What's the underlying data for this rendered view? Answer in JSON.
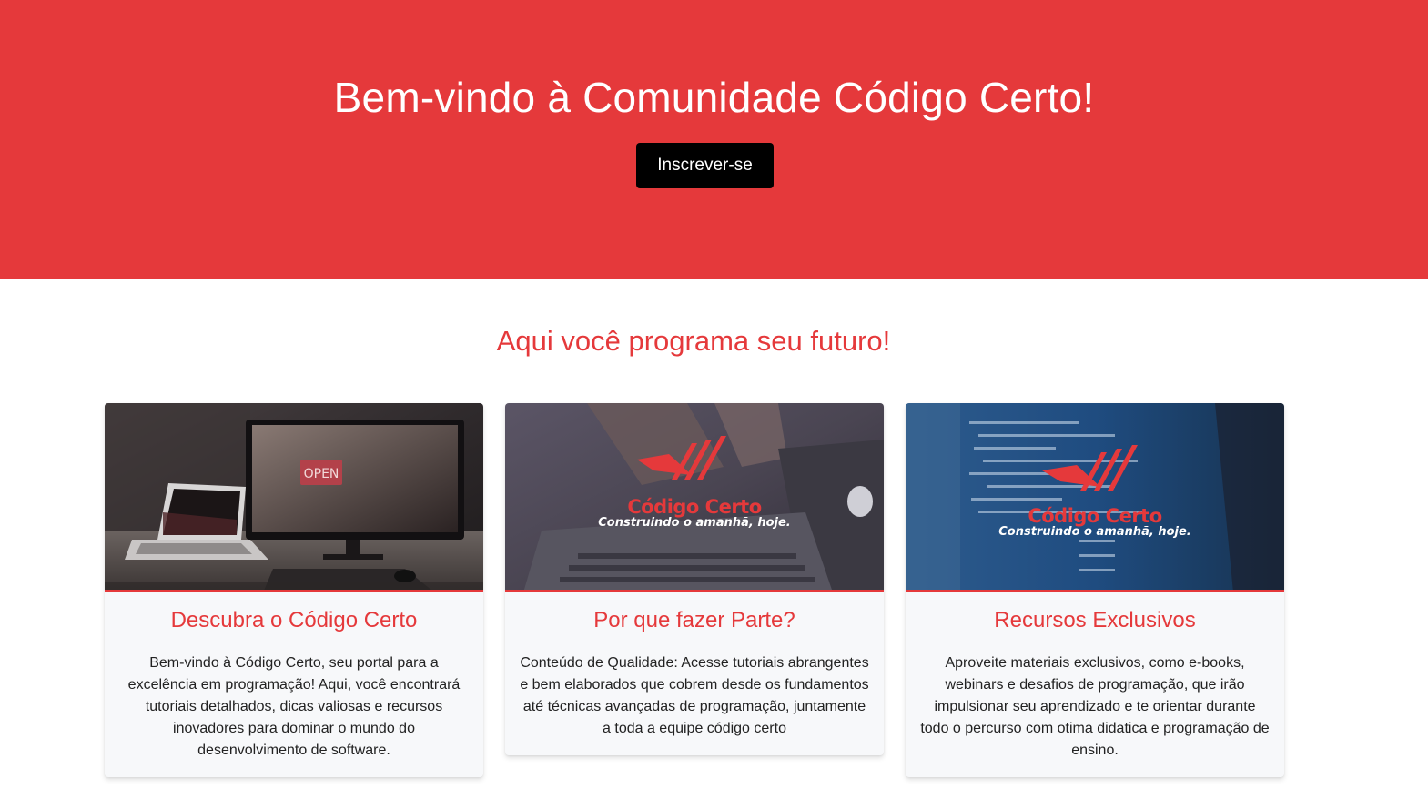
{
  "hero": {
    "title": "Bem-vindo à Comunidade Código Certo!",
    "button_label": "Inscrever-se",
    "background_color": "#e5393b"
  },
  "section": {
    "subtitle": "Aqui você programa seu futuro!"
  },
  "cards": [
    {
      "title": "Descubra o Código Certo",
      "text": "Bem-vindo à Código Certo, seu portal para a excelência em programação! Aqui, você encontrará tutoriais detalhados, dicas valiosas e recursos inovadores para dominar o mundo do desenvolvimento de software.",
      "image_sign": "OPEN"
    },
    {
      "title": "Por que fazer Parte?",
      "text": "Conteúdo de Qualidade: Acesse tutoriais abrangentes e bem elaborados que cobrem desde os fundamentos até técnicas avançadas de programação, juntamente a toda a equipe código certo",
      "brand_name": "Código Certo",
      "brand_tagline": "Construindo o amanhã, hoje."
    },
    {
      "title": "Recursos Exclusivos",
      "text": "Aproveite materiais exclusivos, como e-books, webinars e desafios de programação, que irão impulsionar seu aprendizado e te orientar durante todo o percurso com otima didatica e programação de ensino.",
      "brand_name": "Código Certo",
      "brand_tagline": "Construindo o amanhã, hoje."
    }
  ],
  "colors": {
    "accent": "#e5393b",
    "button": "#000000",
    "card_background": "#f7f8fa"
  }
}
